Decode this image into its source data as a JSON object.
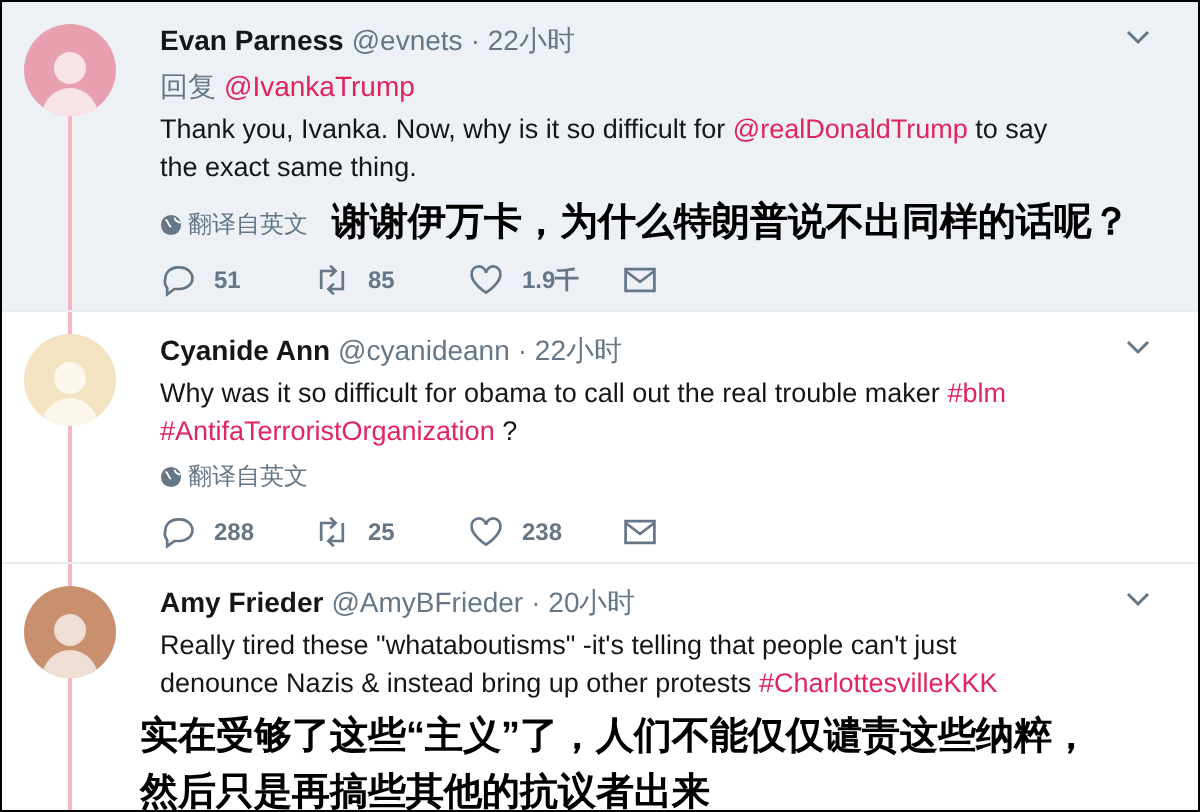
{
  "tweets": [
    {
      "name": "Evan Parness",
      "handle": "@evnets",
      "time": "· 22小时",
      "highlighted": true,
      "reply_label": "回复",
      "reply_handle": "@IvankaTrump",
      "body": [
        {
          "kind": "text",
          "text": "Thank you, Ivanka. Now, why is it so difficult for "
        },
        {
          "kind": "link",
          "text": "@realDonaldTrump"
        },
        {
          "kind": "text",
          "text": " to say the exact same thing."
        }
      ],
      "translate": "翻译自英文",
      "caption": "谢谢伊万卡，为什么特朗普说不出同样的话呢？",
      "replies": "51",
      "retweets": "85",
      "likes": "1.9千"
    },
    {
      "name": "Cyanide Ann",
      "handle": "@cyanideann",
      "time": "· 22小时",
      "highlighted": false,
      "body": [
        {
          "kind": "text",
          "text": "Why was it so difficult for obama to call out the real trouble maker "
        },
        {
          "kind": "link",
          "text": "#blm"
        },
        {
          "kind": "link",
          "text": "#AntifaTerroristOrganization"
        },
        {
          "kind": "text",
          "text": " ?"
        }
      ],
      "translate": "翻译自英文",
      "replies": "288",
      "retweets": "25",
      "likes": "238"
    },
    {
      "name": "Amy Frieder",
      "handle": "@AmyBFrieder",
      "time": "· 20小时",
      "highlighted": false,
      "body": [
        {
          "kind": "text",
          "text": "Really tired these \"whataboutisms\" -it's telling that people can't just denounce Nazis & instead bring up other protests "
        },
        {
          "kind": "link",
          "text": "#CharlottesvilleKKK"
        }
      ],
      "caption_lines": [
        "实在受够了这些“主义”了，人们不能仅仅谴责这些纳粹，",
        "然后只是再搞些其他的抗议者出来"
      ]
    }
  ]
}
